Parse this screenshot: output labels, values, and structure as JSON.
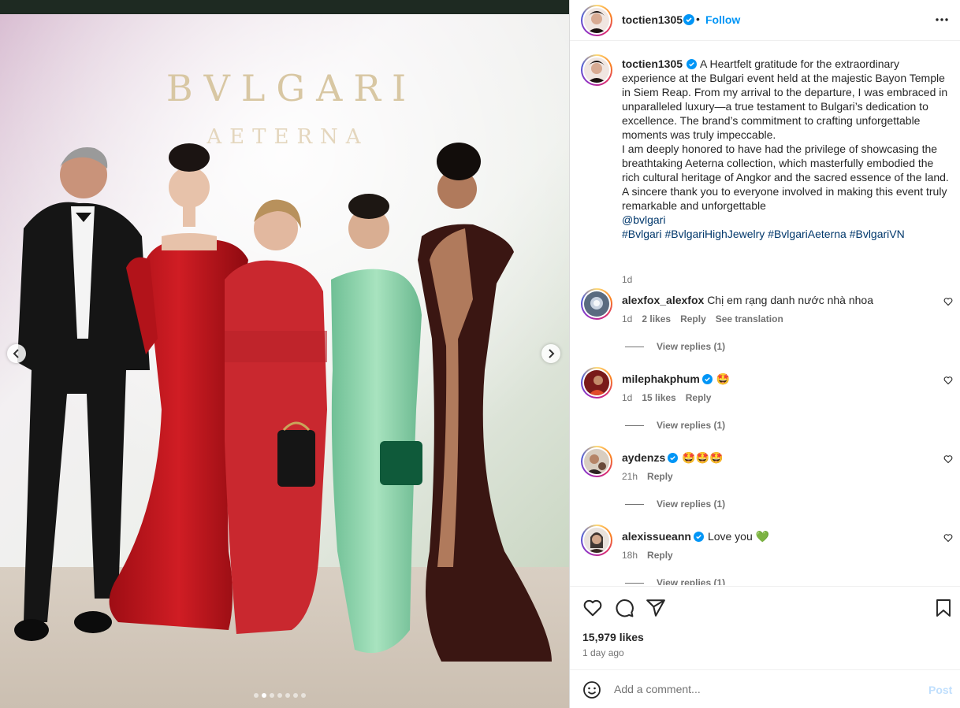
{
  "media": {
    "backdrop_title": "BVLGARI",
    "backdrop_subtitle": "AETERNA",
    "carousel_count": 7,
    "carousel_active": 1
  },
  "header": {
    "username": "toctien1305",
    "separator": "•",
    "follow_label": "Follow",
    "more_icon": "more-horizontal-icon"
  },
  "caption": {
    "username": "toctien1305",
    "paragraphs": [
      "A Heartfelt gratitude for the extraordinary experience at the Bulgari event held at the majestic Bayon Temple in Siem Reap. From my arrival to the departure, I was embraced in unparalleled luxury—a true testament to Bulgari’s dedication to excellence. The brand’s commitment to crafting unforgettable moments was truly impeccable.",
      "I am deeply honored to have had the privilege of showcasing the breathtaking Aeterna collection, which masterfully embodied the rich cultural heritage of Angkor and the sacred essence of the land.",
      "A sincere thank you to everyone involved in making this event truly remarkable and unforgettable"
    ],
    "mention": "@bvlgari",
    "hashtags": "#Bvlgari #BvlgariHighJewelry #BvlgariAeterna #BvlgariVN",
    "time": "1d"
  },
  "comments": [
    {
      "username": "alexfox_alexfox",
      "verified": false,
      "text": "Chị em rạng danh nước nhà nhoa",
      "time": "1d",
      "likes": "2 likes",
      "reply": "Reply",
      "translate": "See translation",
      "replies": "View replies (1)"
    },
    {
      "username": "milephakphum",
      "verified": true,
      "text": "🤩",
      "time": "1d",
      "likes": "15 likes",
      "reply": "Reply",
      "translate": "",
      "replies": "View replies (1)"
    },
    {
      "username": "aydenzs",
      "verified": true,
      "text": "🤩🤩🤩",
      "time": "21h",
      "likes": "",
      "reply": "Reply",
      "translate": "",
      "replies": "View replies (1)"
    },
    {
      "username": "alexissueann",
      "verified": true,
      "text": "Love you 💚",
      "time": "18h",
      "likes": "",
      "reply": "Reply",
      "translate": "",
      "replies": "View replies (1)"
    }
  ],
  "actions": {
    "likes": "15,979 likes",
    "ago": "1 day ago"
  },
  "add_comment": {
    "placeholder": "Add a comment...",
    "post_label": "Post"
  },
  "colors": {
    "accent": "#0095f6",
    "muted": "#737373",
    "link": "#00376b"
  }
}
